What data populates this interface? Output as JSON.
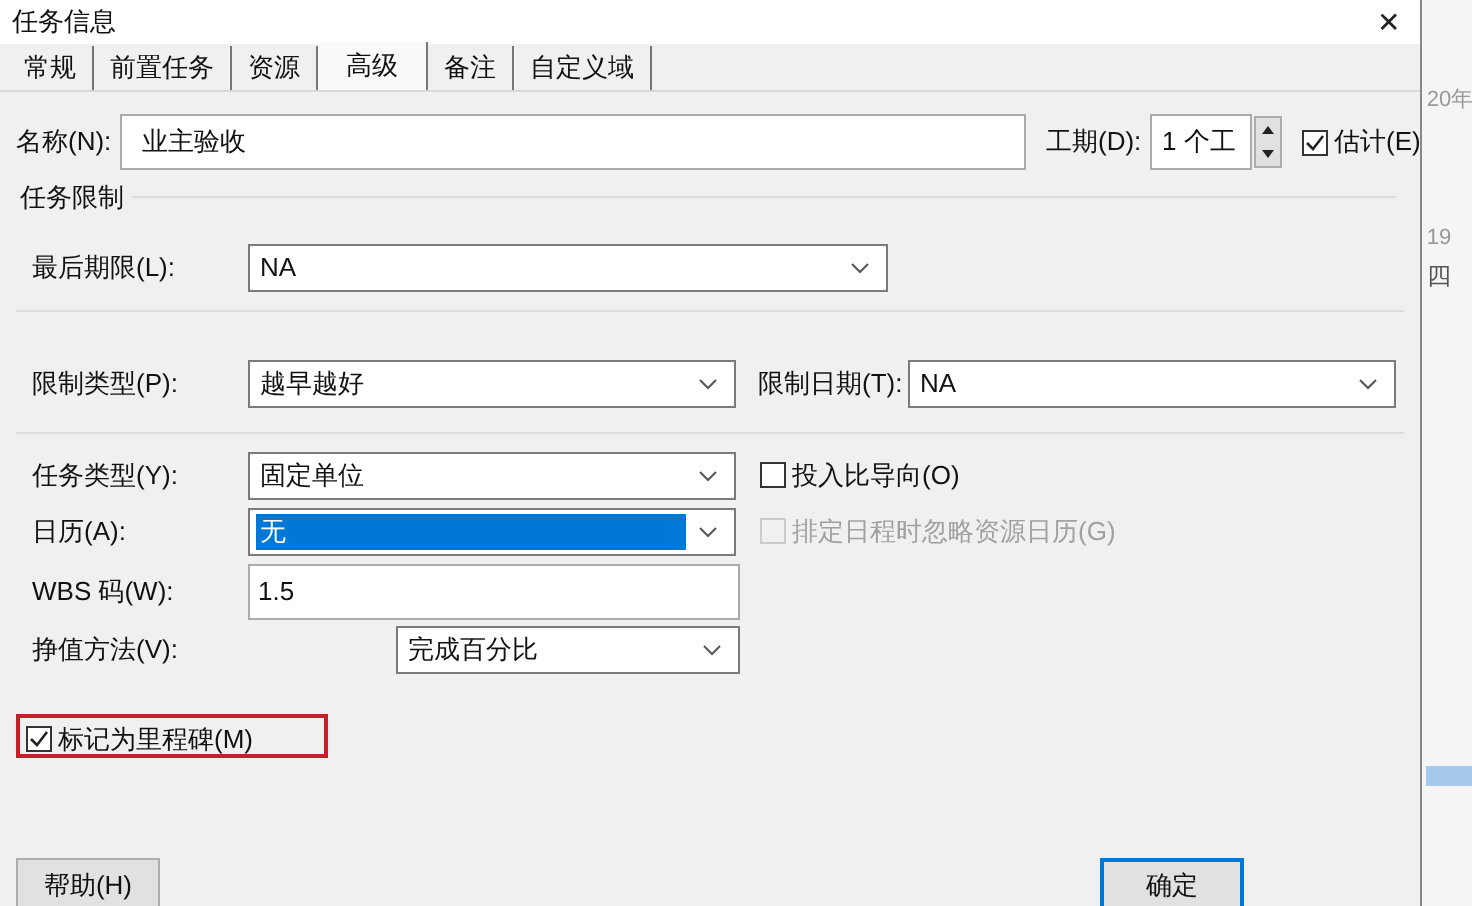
{
  "window": {
    "title": "任务信息",
    "close": "✕"
  },
  "tabs": [
    {
      "label": "常规",
      "selected": false
    },
    {
      "label": "前置任务",
      "selected": false
    },
    {
      "label": "资源",
      "selected": false
    },
    {
      "label": "高级",
      "selected": true
    },
    {
      "label": "备注",
      "selected": false
    },
    {
      "label": "自定义域",
      "selected": false
    }
  ],
  "name": {
    "label": "名称(N):",
    "value": "业主验收"
  },
  "duration": {
    "label": "工期(D):",
    "value": "1 个工"
  },
  "estimated": {
    "label": "估计(E)",
    "checked": true
  },
  "constraints": {
    "title": "任务限制",
    "deadline": {
      "label": "最后期限(L):",
      "value": "NA"
    },
    "type": {
      "label": "限制类型(P):",
      "value": "越早越好"
    },
    "date": {
      "label": "限制日期(T):",
      "value": "NA"
    }
  },
  "task_type": {
    "label": "任务类型(Y):",
    "value": "固定单位"
  },
  "effort_driven": {
    "label": "投入比导向(O)",
    "checked": false,
    "disabled": false
  },
  "calendar": {
    "label": "日历(A):",
    "value": "无",
    "selected": true
  },
  "ignore_resource_calendars": {
    "label": "排定日程时忽略资源日历(G)",
    "checked": false,
    "disabled": true
  },
  "wbs": {
    "label": "WBS 码(W):",
    "value": "1.5"
  },
  "earned_value": {
    "label": "挣值方法(V):",
    "value": "完成百分比"
  },
  "milestone": {
    "label": "标记为里程碑(M)",
    "checked": true,
    "highlighted": true
  },
  "buttons": [
    {
      "label": "帮助(H)",
      "default": false
    },
    {
      "label": "确定",
      "default": true
    }
  ],
  "background_window": {
    "texts": [
      "20年",
      "19",
      "四"
    ]
  }
}
